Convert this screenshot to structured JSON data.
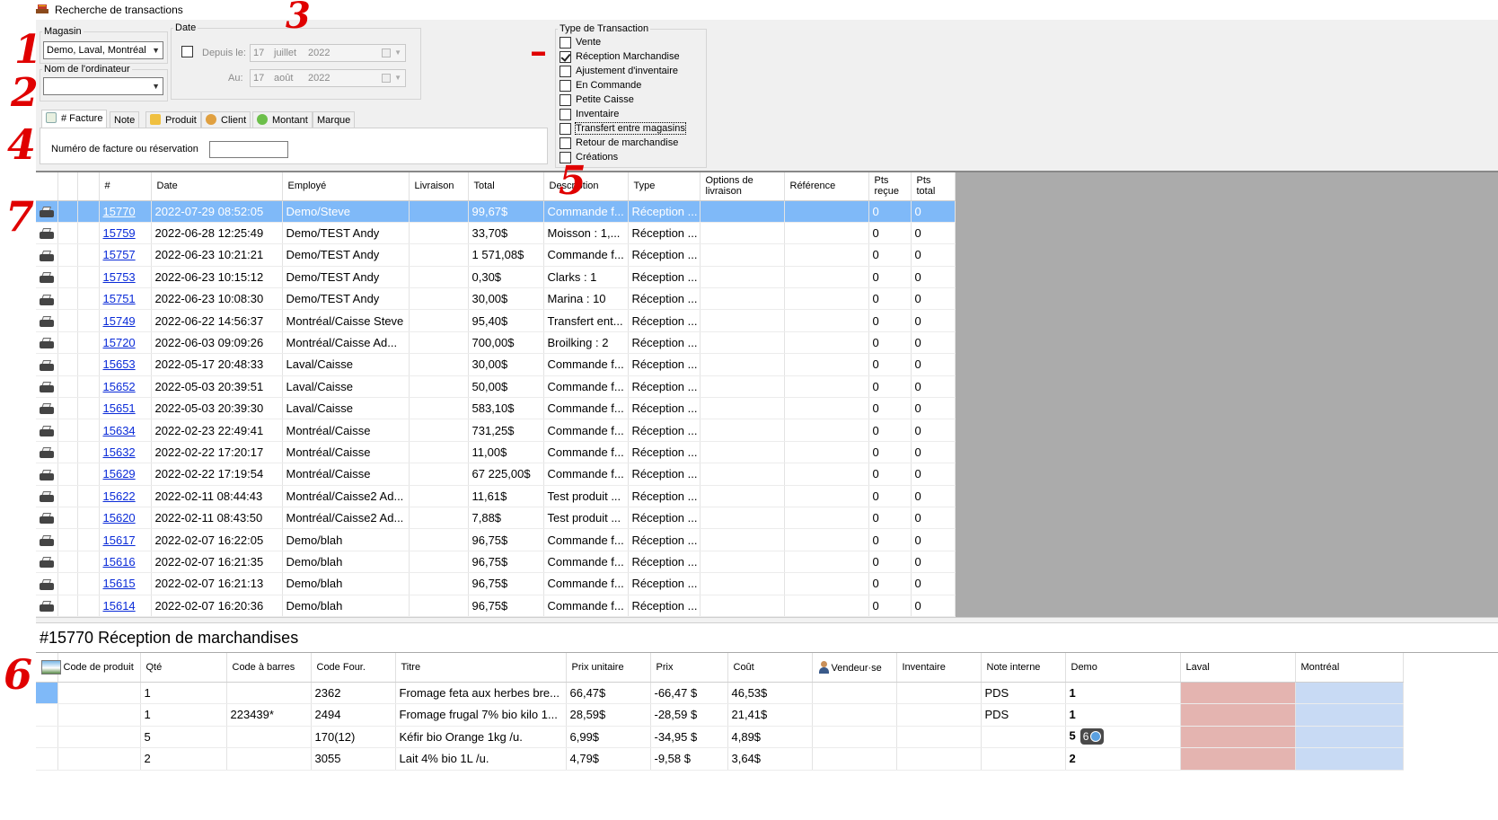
{
  "window": {
    "title": "Recherche de transactions"
  },
  "filters": {
    "store": {
      "legend": "Magasin",
      "value": "Demo, Laval, Montréal"
    },
    "computer": {
      "legend": "Nom de l'ordinateur",
      "value": ""
    },
    "date": {
      "legend": "Date",
      "since_label": "Depuis le:",
      "to_label": "Au:",
      "since": {
        "day": "17",
        "month": "juillet",
        "year": "2022"
      },
      "to": {
        "day": "17",
        "month": "août",
        "year": "2022"
      },
      "enabled": false
    },
    "tabs": [
      "# Facture",
      "Note",
      "Produit",
      "Client",
      "Montant",
      "Marque"
    ],
    "invoice_label": "Numéro de facture ou réservation",
    "invoice_value": ""
  },
  "transaction_types": {
    "legend": "Type de Transaction",
    "items": [
      {
        "label": "Vente",
        "checked": false
      },
      {
        "label": "Réception Marchandise",
        "checked": true
      },
      {
        "label": "Ajustement d'inventaire",
        "checked": false
      },
      {
        "label": "En Commande",
        "checked": false
      },
      {
        "label": "Petite Caisse",
        "checked": false
      },
      {
        "label": "Inventaire",
        "checked": false
      },
      {
        "label": "Transfert entre magasins",
        "checked": false
      },
      {
        "label": "Retour de marchandise",
        "checked": false
      },
      {
        "label": "Créations",
        "checked": false
      }
    ]
  },
  "transactions": {
    "columns": [
      "#",
      "Date",
      "Employé",
      "Livraison",
      "Total",
      "Description",
      "Type",
      "Options de livraison",
      "Référence",
      "Pts reçue",
      "Pts total"
    ],
    "rows": [
      [
        "15770",
        "2022-07-29 08:52:05",
        "Demo/Steve",
        "",
        "99,67$",
        "Commande f...",
        "Réception ...",
        "",
        "",
        "0",
        "0"
      ],
      [
        "15759",
        "2022-06-28 12:25:49",
        "Demo/TEST Andy",
        "",
        "33,70$",
        "Moisson : 1,...",
        "Réception ...",
        "",
        "",
        "0",
        "0"
      ],
      [
        "15757",
        "2022-06-23 10:21:21",
        "Demo/TEST Andy",
        "",
        "1 571,08$",
        "Commande f...",
        "Réception ...",
        "",
        "",
        "0",
        "0"
      ],
      [
        "15753",
        "2022-06-23 10:15:12",
        "Demo/TEST Andy",
        "",
        "0,30$",
        "Clarks : 1",
        "Réception ...",
        "",
        "",
        "0",
        "0"
      ],
      [
        "15751",
        "2022-06-23 10:08:30",
        "Demo/TEST Andy",
        "",
        "30,00$",
        "Marina : 10",
        "Réception ...",
        "",
        "",
        "0",
        "0"
      ],
      [
        "15749",
        "2022-06-22 14:56:37",
        "Montréal/Caisse Steve",
        "",
        "95,40$",
        "Transfert ent...",
        "Réception ...",
        "",
        "",
        "0",
        "0"
      ],
      [
        "15720",
        "2022-06-03 09:09:26",
        "Montréal/Caisse Ad...",
        "",
        "700,00$",
        "Broilking : 2",
        "Réception ...",
        "",
        "",
        "0",
        "0"
      ],
      [
        "15653",
        "2022-05-17 20:48:33",
        "Laval/Caisse",
        "",
        "30,00$",
        "Commande f...",
        "Réception ...",
        "",
        "",
        "0",
        "0"
      ],
      [
        "15652",
        "2022-05-03 20:39:51",
        "Laval/Caisse",
        "",
        "50,00$",
        "Commande f...",
        "Réception ...",
        "",
        "",
        "0",
        "0"
      ],
      [
        "15651",
        "2022-05-03 20:39:30",
        "Laval/Caisse",
        "",
        "583,10$",
        "Commande f...",
        "Réception ...",
        "",
        "",
        "0",
        "0"
      ],
      [
        "15634",
        "2022-02-23 22:49:41",
        "Montréal/Caisse",
        "",
        "731,25$",
        "Commande f...",
        "Réception ...",
        "",
        "",
        "0",
        "0"
      ],
      [
        "15632",
        "2022-02-22 17:20:17",
        "Montréal/Caisse",
        "",
        "11,00$",
        "Commande f...",
        "Réception ...",
        "",
        "",
        "0",
        "0"
      ],
      [
        "15629",
        "2022-02-22 17:19:54",
        "Montréal/Caisse",
        "",
        "67 225,00$",
        "Commande f...",
        "Réception ...",
        "",
        "",
        "0",
        "0"
      ],
      [
        "15622",
        "2022-02-11 08:44:43",
        "Montréal/Caisse2 Ad...",
        "",
        "11,61$",
        "Test produit ...",
        "Réception ...",
        "",
        "",
        "0",
        "0"
      ],
      [
        "15620",
        "2022-02-11 08:43:50",
        "Montréal/Caisse2 Ad...",
        "",
        "7,88$",
        "Test produit ...",
        "Réception ...",
        "",
        "",
        "0",
        "0"
      ],
      [
        "15617",
        "2022-02-07 16:22:05",
        "Demo/blah",
        "",
        "96,75$",
        "Commande f...",
        "Réception ...",
        "",
        "",
        "0",
        "0"
      ],
      [
        "15616",
        "2022-02-07 16:21:35",
        "Demo/blah",
        "",
        "96,75$",
        "Commande f...",
        "Réception ...",
        "",
        "",
        "0",
        "0"
      ],
      [
        "15615",
        "2022-02-07 16:21:13",
        "Demo/blah",
        "",
        "96,75$",
        "Commande f...",
        "Réception ...",
        "",
        "",
        "0",
        "0"
      ],
      [
        "15614",
        "2022-02-07 16:20:36",
        "Demo/blah",
        "",
        "96,75$",
        "Commande f...",
        "Réception ...",
        "",
        "",
        "0",
        "0"
      ]
    ]
  },
  "detail": {
    "title": "#15770 Réception de marchandises",
    "columns": [
      "Code de produit",
      "Qté",
      "Code à barres",
      "Code Four.",
      "Titre",
      "Prix unitaire",
      "Prix",
      "Coût",
      "Vendeur·se",
      "Inventaire",
      "Note interne",
      "Demo",
      "Laval",
      "Montréal"
    ],
    "rows": [
      [
        "",
        "1",
        "",
        "2362",
        "Fromage feta aux herbes bre...",
        "66,47$",
        "-66,47 $",
        "46,53$",
        "",
        "",
        "PDS",
        "1",
        "",
        ""
      ],
      [
        "",
        "1",
        "223439*",
        "2494",
        "Fromage frugal 7% bio kilo 1...",
        "28,59$",
        "-28,59 $",
        "21,41$",
        "",
        "",
        "PDS",
        "1",
        "",
        ""
      ],
      [
        "",
        "5",
        "",
        "170(12)",
        "Kéfir bio Orange 1kg /u.",
        "6,99$",
        "-34,95 $",
        "4,89$",
        "",
        "",
        "",
        "5",
        "",
        ""
      ],
      [
        "",
        "2",
        "",
        "3055",
        "Lait 4% bio 1L /u.",
        "4,79$",
        "-9,58 $",
        "3,64$",
        "",
        "",
        "",
        "2",
        "",
        ""
      ]
    ],
    "badge": "6"
  },
  "annotations": [
    "1",
    "2",
    "3",
    "4",
    "5",
    "6",
    "7",
    "–"
  ],
  "colors": {
    "selection": "#7fb9f8",
    "link": "#0a2bd8",
    "laval_cell": "#e4b4b0",
    "montreal_cell": "#c8daf4",
    "annotation": "#e00000"
  }
}
